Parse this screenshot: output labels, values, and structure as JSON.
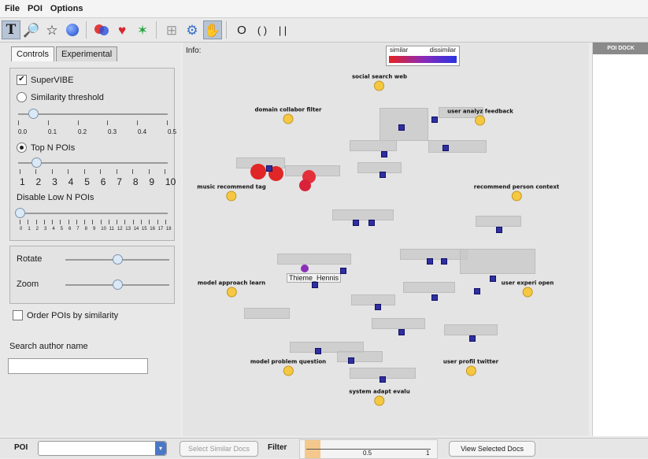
{
  "menu": [
    "File",
    "POI",
    "Options"
  ],
  "toolbar": {
    "icons": [
      "text-tool-icon",
      "magnifier-icon",
      "star-icon",
      "sphere-icon",
      "venn-icon",
      "heart-icon",
      "sparkle-icon",
      "grid-icon",
      "gear-icon",
      "hand-icon"
    ],
    "shape_glyphs": [
      "O",
      "( )",
      "| |"
    ]
  },
  "tabs": [
    "Controls",
    "Experimental"
  ],
  "controls": {
    "supervibe": "SuperVIBE",
    "similarity_threshold": "Similarity threshold",
    "similarity_labels": [
      "0.0",
      "0.1",
      "0.2",
      "0.3",
      "0.4",
      "0.5"
    ],
    "similarity_value": 0.05,
    "top_n": "Top N POIs",
    "top_n_labels": [
      "1",
      "2",
      "3",
      "4",
      "5",
      "6",
      "7",
      "8",
      "9",
      "10"
    ],
    "top_n_value": 2,
    "disable_low": "Disable Low N POIs",
    "disable_low_labels": [
      "0",
      "1",
      "2",
      "3",
      "4",
      "5",
      "6",
      "7",
      "8",
      "9",
      "10",
      "11",
      "12",
      "13",
      "14",
      "15",
      "16",
      "17",
      "18"
    ],
    "disable_low_value": 0,
    "rotate": "Rotate",
    "rotate_value": 0.5,
    "zoom": "Zoom",
    "zoom_value": 0.5,
    "order": "Order POIs by similarity",
    "search_label": "Search author name",
    "search_value": ""
  },
  "canvas": {
    "info": "Info:",
    "legend_similar": "similar",
    "legend_dissimilar": "dissimilar",
    "author_label": "Thieme_Hennis"
  },
  "pois": [
    {
      "label": "social search web"
    },
    {
      "label": "domain collabor filter"
    },
    {
      "label": "user analyz feedback"
    },
    {
      "label": "music recommend tag"
    },
    {
      "label": "recommend person context"
    },
    {
      "label": "model approach learn"
    },
    {
      "label": "user experi open"
    },
    {
      "label": "model problem question"
    },
    {
      "label": "user profil twitter"
    },
    {
      "label": "system adapt evalu"
    }
  ],
  "dock": {
    "title": "POI DOCK"
  },
  "bottom": {
    "poi_label": "POI",
    "select_similar": "Select Similar Docs",
    "filter_label": "Filter",
    "filter_mid": "0.5",
    "filter_max": "1",
    "view_selected": "View Selected Docs"
  },
  "colors": {
    "similar": "#e52222",
    "dissimilar": "#2a35e0",
    "poi": "#f5c842"
  }
}
